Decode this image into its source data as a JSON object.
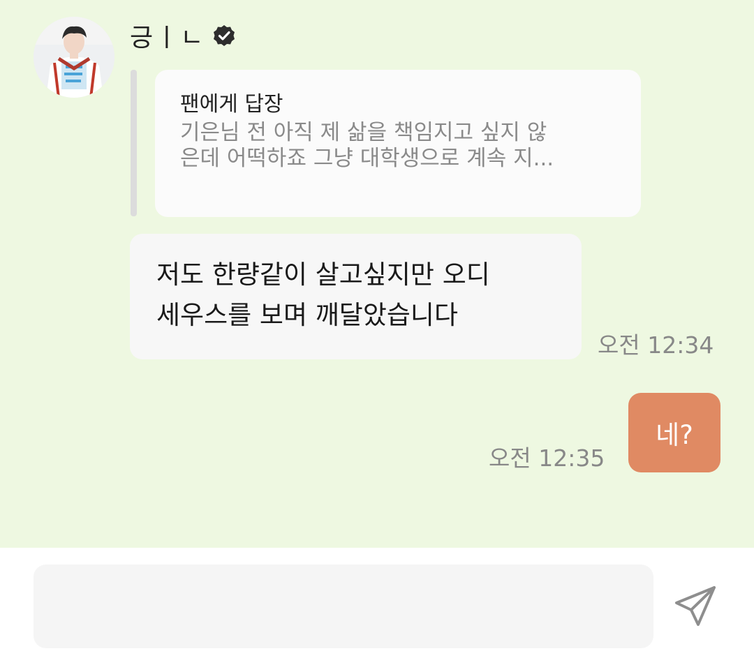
{
  "sender": {
    "name": "긍ㅣㄴ",
    "verified_icon": "verified-badge-icon",
    "avatar": "profile-avatar"
  },
  "quote": {
    "title": "팬에게 답장",
    "lines": [
      "기은님 전 아직 제 삶을 책임지고 싶지 않",
      "은데 어떡하죠 그냥 대학생으로 계속 지..."
    ]
  },
  "messages": [
    {
      "lines": [
        "저도 한량같이 살고싶지만 오디",
        "세우스를 보며 깨달았습니다"
      ],
      "time": "오전 12:34"
    }
  ],
  "my_message": {
    "text": "네?",
    "time": "오전 12:35"
  },
  "input": {
    "value": "",
    "placeholder": ""
  },
  "colors": {
    "chat_background": "#eef8e1",
    "my_bubble": "#e08a63",
    "other_bubble": "#f7f7f7",
    "time_text": "#888888"
  },
  "icons": {
    "send": "send-icon"
  }
}
